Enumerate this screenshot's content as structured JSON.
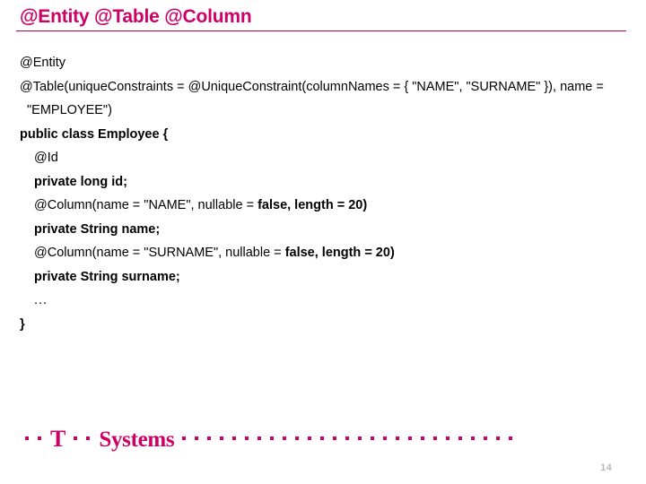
{
  "slide": {
    "title": "@Entity @Table @Column",
    "accent_color": "#cc0066",
    "rule_color": "#b3005c",
    "background": "#ffffff",
    "text_color": "#000000"
  },
  "code": {
    "lines": [
      {
        "id": "line-entity",
        "indent": 0,
        "segments": [
          {
            "text": "@Entity",
            "bold": false
          }
        ]
      },
      {
        "id": "line-table",
        "indent": 0,
        "hanging": true,
        "segments": [
          {
            "text": "@Table(uniqueConstraints = @UniqueConstraint(columnNames = { \"NAME\", \"SURNAME\" }), name = \"EMPLOYEE\")",
            "bold": false
          }
        ]
      },
      {
        "id": "line-class",
        "indent": 0,
        "segments": [
          {
            "text": "public class Employee {",
            "bold": true
          }
        ]
      },
      {
        "id": "line-id-annotation",
        "indent": 1,
        "segments": [
          {
            "text": "@Id",
            "bold": false
          }
        ]
      },
      {
        "id": "line-id-field",
        "indent": 1,
        "segments": [
          {
            "text": "private long id;",
            "bold": true
          }
        ]
      },
      {
        "id": "line-column-name",
        "indent": 1,
        "segments": [
          {
            "text": "@Column(name = \"NAME\", nullable = ",
            "bold": false
          },
          {
            "text": "false, length = 20)",
            "bold": true
          }
        ]
      },
      {
        "id": "line-name-field",
        "indent": 1,
        "segments": [
          {
            "text": "private String name;",
            "bold": true
          }
        ]
      },
      {
        "id": "line-column-surname",
        "indent": 1,
        "segments": [
          {
            "text": "@Column(name = \"SURNAME\", nullable = ",
            "bold": false
          },
          {
            "text": "false, length = 20)",
            "bold": true
          }
        ]
      },
      {
        "id": "line-surname-field",
        "indent": 1,
        "segments": [
          {
            "text": "private String surname;",
            "bold": true
          }
        ]
      },
      {
        "id": "line-ellipsis",
        "indent": 1,
        "segments": [
          {
            "text": "...",
            "bold": false
          }
        ]
      },
      {
        "id": "line-close-brace",
        "indent": 0,
        "segments": [
          {
            "text": "}",
            "bold": true
          }
        ]
      }
    ]
  },
  "footer": {
    "logo": {
      "mark": "T",
      "word": "Systems",
      "color": "#cc0066",
      "lead_dots": 2,
      "mid_dots": 2,
      "trail_dots": 27
    },
    "page_number": "14"
  }
}
